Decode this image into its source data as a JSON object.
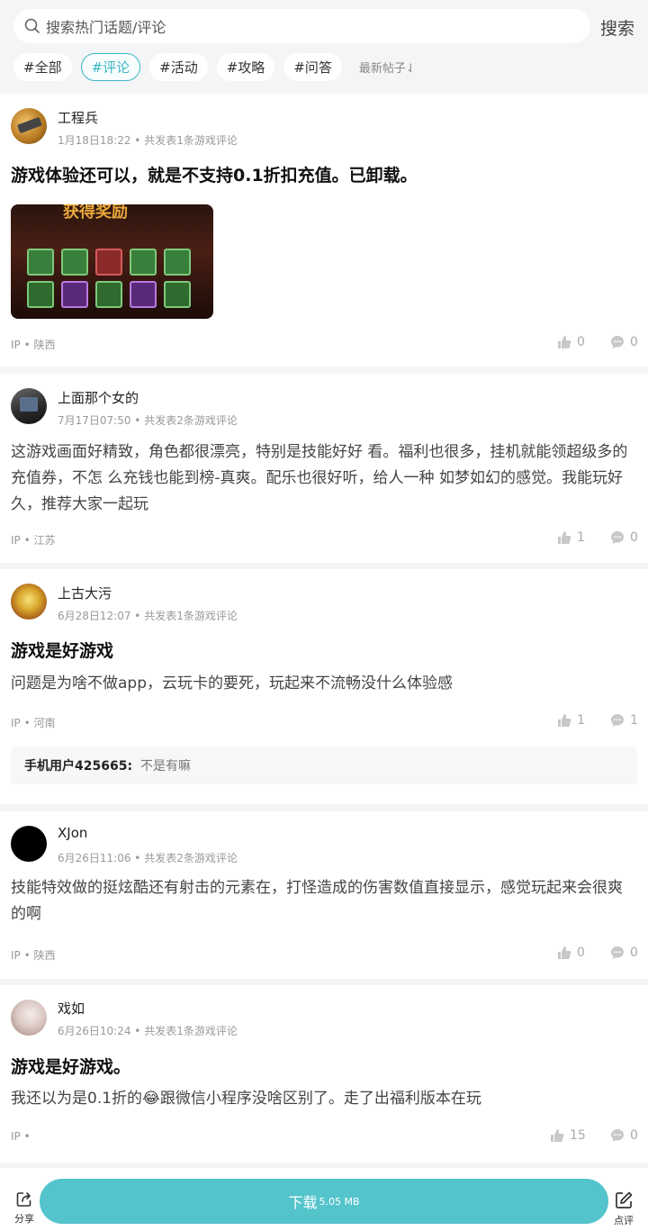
{
  "search": {
    "placeholder": "搜索热门话题/评论",
    "button": "搜索"
  },
  "tabs": [
    {
      "label": "#全部",
      "active": false
    },
    {
      "label": "#评论",
      "active": true
    },
    {
      "label": "#活动",
      "active": false
    },
    {
      "label": "#攻略",
      "active": false
    },
    {
      "label": "#问答",
      "active": false
    }
  ],
  "sort_label": "最新帖子⇃",
  "posts": [
    {
      "username": "工程兵",
      "meta": "1月18日18:22 • 共发表1条游戏评论",
      "title": "游戏体验还可以，就是不支持0.1折扣充值。已卸载。",
      "image_caption": "获得奖励",
      "ip": "IP • 陕西",
      "likes": "0",
      "comments": "0"
    },
    {
      "username": "上面那个女的",
      "meta": "7月17日07:50 • 共发表2条游戏评论",
      "body": "这游戏画面好精致，角色都很漂亮，特别是技能好好 看。福利也很多，挂机就能领超级多的充值券，不怎 么充钱也能到榜-真爽。配乐也很好听，给人一种 如梦如幻的感觉。我能玩好久，推荐大家一起玩",
      "ip": "IP • 江苏",
      "likes": "1",
      "comments": "0"
    },
    {
      "username": "上古大污",
      "meta": "6月28日12:07 • 共发表1条游戏评论",
      "title": "游戏是好游戏",
      "body": "问题是为啥不做app，云玩卡的要死，玩起来不流畅没什么体验感",
      "ip": "IP • 河南",
      "likes": "1",
      "comments": "1",
      "reply": {
        "user": "手机用户425665:",
        "text": "不是有嘛"
      }
    },
    {
      "username": "XJon",
      "meta": "6月26日11:06 • 共发表2条游戏评论",
      "body": "技能特效做的挺炫酷还有射击的元素在，打怪造成的伤害数值直接显示，感觉玩起来会很爽的啊",
      "ip": "IP • 陕西",
      "likes": "0",
      "comments": "0"
    },
    {
      "username": "戏如",
      "meta": "6月26日10:24 • 共发表1条游戏评论",
      "title": "游戏是好游戏。",
      "body_before": "我还以为是0.1折的",
      "body_emoji": "😂",
      "body_after": "跟微信小程序没啥区别了。走了出福利版本在玩",
      "ip": "IP •",
      "likes": "15",
      "comments": "0"
    }
  ],
  "bottom": {
    "share": "分享",
    "download": "下载",
    "download_size": "5.05 MB",
    "rate": "点评"
  },
  "colors": {
    "accent": "#3bb7c4",
    "download": "#54c4cc"
  }
}
